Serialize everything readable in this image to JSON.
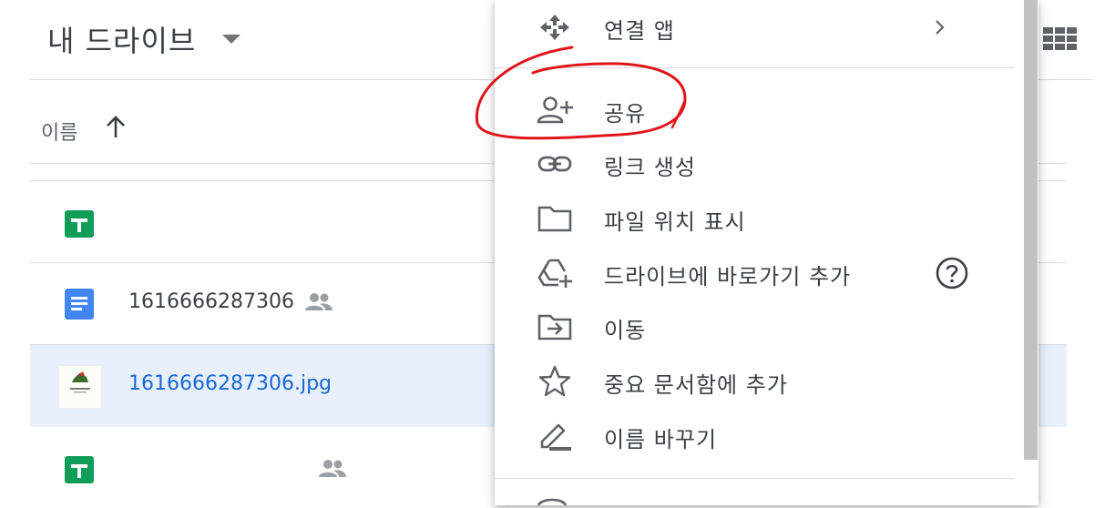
{
  "header": {
    "title": "내 드라이브",
    "sort_label": "이름"
  },
  "files": [
    {
      "name": "",
      "type": "sheets-icon",
      "shared": false
    },
    {
      "name": "1616666287306",
      "type": "docs-icon",
      "shared": true
    },
    {
      "name": "1616666287306.jpg",
      "type": "image-thumbnail",
      "shared": false,
      "selected": true
    },
    {
      "name": "",
      "type": "sheets-icon",
      "shared": true
    }
  ],
  "menu": {
    "items": [
      {
        "label": "연결 앱",
        "icon": "move-arrows-icon",
        "has_submenu": true
      },
      {
        "label": "공유",
        "icon": "add-person-icon"
      },
      {
        "label": "링크 생성",
        "icon": "link-icon"
      },
      {
        "label": "파일 위치 표시",
        "icon": "folder-icon"
      },
      {
        "label": "드라이브에 바로가기 추가",
        "icon": "add-to-drive-icon",
        "has_help": true
      },
      {
        "label": "이동",
        "icon": "move-to-folder-icon"
      },
      {
        "label": "중요 문서함에 추가",
        "icon": "star-icon"
      },
      {
        "label": "이름 바꾸기",
        "icon": "pencil-icon"
      }
    ]
  },
  "colors": {
    "sheets_green": "#0f9d58",
    "docs_blue": "#4285f4",
    "selected_row": "#e8f0fe",
    "selected_text": "#1967d2",
    "annotation_red": "#e0161b",
    "icon_gray": "#5f6368"
  }
}
